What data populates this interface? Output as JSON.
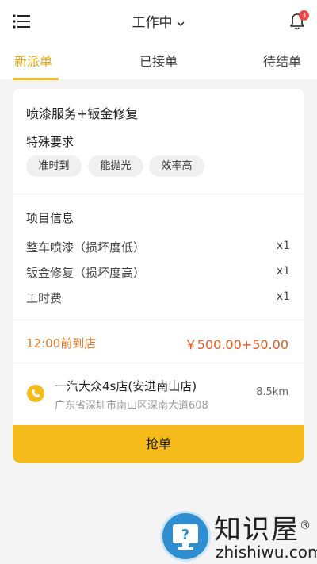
{
  "header": {
    "title": "工作中",
    "notification_count": "3"
  },
  "tabs": [
    {
      "label": "新派单",
      "active": true
    },
    {
      "label": "已接单",
      "active": false
    },
    {
      "label": "待结单",
      "active": false
    }
  ],
  "order": {
    "title": "喷漆服务+钣金修复",
    "requirements_label": "特殊要求",
    "tags": [
      "准时到",
      "能抛光",
      "效率高"
    ],
    "project_info_label": "项目信息",
    "items": [
      {
        "name": "整车喷漆（损坏度低）",
        "qty": "x1"
      },
      {
        "name": "钣金修复（损坏度高）",
        "qty": "x1"
      },
      {
        "name": "工时费",
        "qty": "x1"
      }
    ],
    "arrival_time": "12:00前到店",
    "price": "￥500.00+50.00",
    "shop_name": "一汽大众4s店(安进南山店)",
    "shop_address": "广东省深圳市南山区深南大道608",
    "distance": "8.5km",
    "grab_button": "抢单"
  },
  "watermark": {
    "text": "知识屋",
    "registered": "®",
    "url": "zhishiwu.com"
  },
  "colors": {
    "accent": "#f5bb1a",
    "active_tab": "#e8a814",
    "price": "#e05a22",
    "arrival": "#e87722",
    "badge": "#f04848"
  }
}
